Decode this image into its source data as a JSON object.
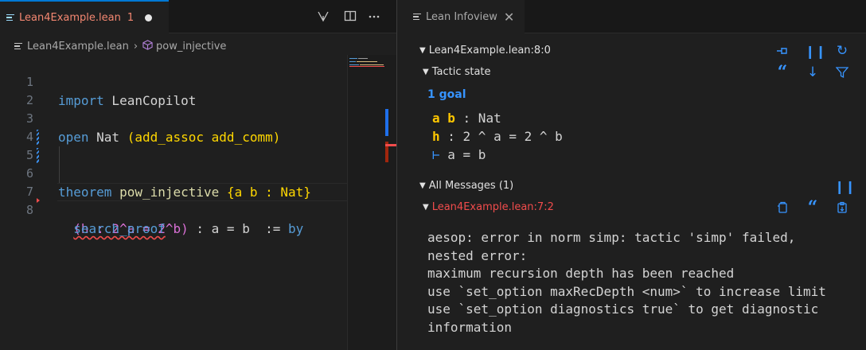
{
  "editor": {
    "tab": {
      "filename": "Lean4Example.lean",
      "problem_count": "1"
    },
    "breadcrumb": {
      "file": "Lean4Example.lean",
      "symbol": "pow_injective"
    },
    "code": {
      "line_numbers": [
        "1",
        "2",
        "3",
        "4",
        "5",
        "6",
        "7",
        "8"
      ],
      "l1_kw": "import",
      "l1_rest": " LeanCopilot",
      "l3_kw": "open",
      "l3_a": " Nat ",
      "l3_b": "(add_assoc add_comm)",
      "l5_kw": "theorem",
      "l5_name": " pow_injective ",
      "l5_b": "{a b : Nat}",
      "l6_indent": "  ",
      "l6_a": "(h : 2^a = 2^b)",
      "l6_b": " : a = b  := ",
      "l6_kw": "by",
      "l7_indent": "  ",
      "l7_tactic": "search_proof"
    }
  },
  "infoview": {
    "tab_title": "Lean Infoview",
    "position_header": "Lean4Example.lean:8:0",
    "tactic_state_label": "Tactic state",
    "goal_count": "1 goal",
    "hyp1_names": "a b",
    "hyp1_type": " : Nat",
    "hyp2_name": "h",
    "hyp2_type": " : 2 ^ a = 2 ^ b",
    "goal_turnstile": "⊢",
    "goal": " a = b",
    "all_messages_label": "All Messages (1)",
    "message_location": "Lean4Example.lean:7:2",
    "error_text": "aesop: error in norm simp: tactic 'simp' failed,\nnested error:\nmaximum recursion depth has been reached\nuse `set_option maxRecDepth <num>` to increase limit\nuse `set_option diagnostics true` to get diagnostic\ninformation"
  },
  "colors": {
    "accent": "#3794ff",
    "error": "#f14c4c",
    "keyword": "#569cd6",
    "function": "#dcdcaa",
    "hyp_name": "#ffc700"
  },
  "icons": [
    "lines-icon",
    "split-editor-icon",
    "more-icon",
    "branch-icon",
    "cube-icon",
    "close-icon",
    "pin-icon",
    "pause-icon",
    "refresh-icon",
    "quote-icon",
    "arrow-down-icon",
    "filter-icon",
    "copy-icon",
    "paste-icon"
  ]
}
